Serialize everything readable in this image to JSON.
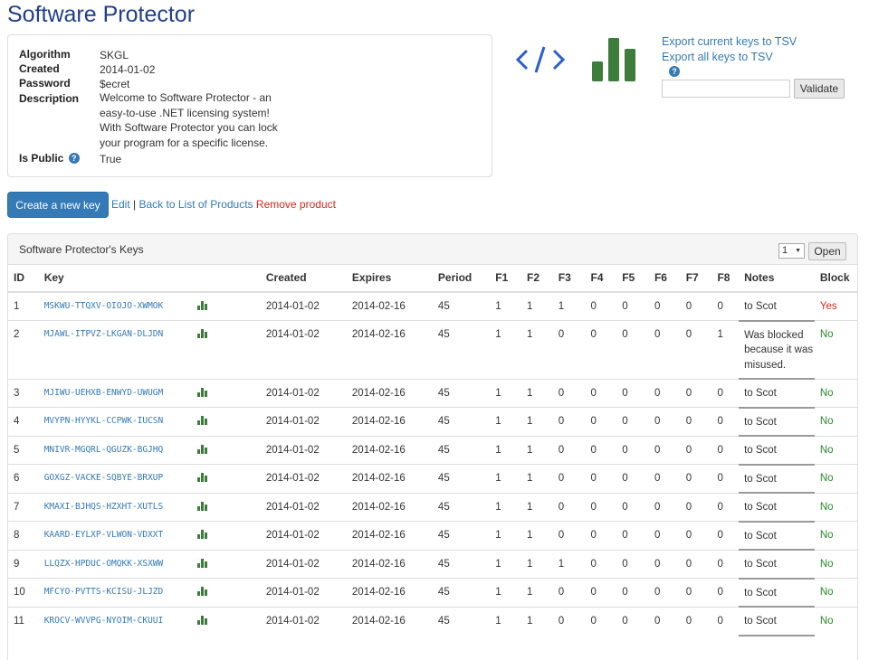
{
  "page": {
    "title": "Software Protector"
  },
  "product": {
    "fields": [
      {
        "label": "Algorithm",
        "value": "SKGL"
      },
      {
        "label": "Created",
        "value": "2014-01-02"
      },
      {
        "label": "Password",
        "value": "$ecret"
      },
      {
        "label": "Description",
        "value": "Welcome to Software Protector - an easy-to-use .NET licensing system! With Software Protector you can lock your program for a specific license."
      },
      {
        "label": "Is Public",
        "value": "True"
      }
    ]
  },
  "links": {
    "export_current": "Export current keys to TSV",
    "export_all": "Export all keys to TSV"
  },
  "validate": {
    "placeholder": "",
    "button": "Validate"
  },
  "actions": {
    "create": "Create a new key",
    "edit": "Edit",
    "separator": "|",
    "back": "Back to List of Products",
    "remove": "Remove product"
  },
  "keys_panel": {
    "title": "Software Protector's Keys",
    "page_value": "1",
    "open_button": "Open",
    "columns": [
      "ID",
      "Key",
      "",
      "Created",
      "Expires",
      "Period",
      "F1",
      "F2",
      "F3",
      "F4",
      "F5",
      "F6",
      "F7",
      "F8",
      "Notes",
      "Block"
    ],
    "rows": [
      {
        "id": "1",
        "key": "MSKWU-TTQXV-OIOJO-XWMOK",
        "created": "2014-01-02",
        "expires": "2014-02-16",
        "period": "45",
        "f": [
          "1",
          "1",
          "1",
          "0",
          "0",
          "0",
          "0",
          "0"
        ],
        "notes": "to Scot",
        "block": "Yes"
      },
      {
        "id": "2",
        "key": "MJAWL-ITPVZ-LKGAN-DLJDN",
        "created": "2014-01-02",
        "expires": "2014-02-16",
        "period": "45",
        "f": [
          "1",
          "1",
          "0",
          "0",
          "0",
          "0",
          "0",
          "1"
        ],
        "notes": "Was blocked because it was misused.",
        "block": "No"
      },
      {
        "id": "3",
        "key": "MJIWU-UEHXB-ENWYD-UWUGM",
        "created": "2014-01-02",
        "expires": "2014-02-16",
        "period": "45",
        "f": [
          "1",
          "1",
          "0",
          "0",
          "0",
          "0",
          "0",
          "0"
        ],
        "notes": "to Scot",
        "block": "No"
      },
      {
        "id": "4",
        "key": "MVYPN-HYYKL-CCPWK-IUCSN",
        "created": "2014-01-02",
        "expires": "2014-02-16",
        "period": "45",
        "f": [
          "1",
          "1",
          "0",
          "0",
          "0",
          "0",
          "0",
          "0"
        ],
        "notes": "to Scot",
        "block": "No"
      },
      {
        "id": "5",
        "key": "MNIVR-MGQRL-QGUZK-BGJHQ",
        "created": "2014-01-02",
        "expires": "2014-02-16",
        "period": "45",
        "f": [
          "1",
          "1",
          "0",
          "0",
          "0",
          "0",
          "0",
          "0"
        ],
        "notes": "to Scot",
        "block": "No"
      },
      {
        "id": "6",
        "key": "GOXGZ-VACKE-SQBYE-BRXUP",
        "created": "2014-01-02",
        "expires": "2014-02-16",
        "period": "45",
        "f": [
          "1",
          "1",
          "0",
          "0",
          "0",
          "0",
          "0",
          "0"
        ],
        "notes": "to Scot",
        "block": "No"
      },
      {
        "id": "7",
        "key": "KMAXI-BJHQS-HZXHT-XUTLS",
        "created": "2014-01-02",
        "expires": "2014-02-16",
        "period": "45",
        "f": [
          "1",
          "1",
          "0",
          "0",
          "0",
          "0",
          "0",
          "0"
        ],
        "notes": "to Scot",
        "block": "No"
      },
      {
        "id": "8",
        "key": "KAARD-EYLXP-VLWON-VDXXT",
        "created": "2014-01-02",
        "expires": "2014-02-16",
        "period": "45",
        "f": [
          "1",
          "1",
          "0",
          "0",
          "0",
          "0",
          "0",
          "0"
        ],
        "notes": "to Scot",
        "block": "No"
      },
      {
        "id": "9",
        "key": "LLQZX-HPDUC-OMQKK-XSXWW",
        "created": "2014-01-02",
        "expires": "2014-02-16",
        "period": "45",
        "f": [
          "1",
          "1",
          "1",
          "0",
          "0",
          "0",
          "0",
          "0"
        ],
        "notes": "to Scot",
        "block": "No"
      },
      {
        "id": "10",
        "key": "MFCYO-PVTTS-KCISU-JLJZD",
        "created": "2014-01-02",
        "expires": "2014-02-16",
        "period": "45",
        "f": [
          "1",
          "1",
          "0",
          "0",
          "0",
          "0",
          "0",
          "0"
        ],
        "notes": "to Scot",
        "block": "No"
      },
      {
        "id": "11",
        "key": "KROCV-WVVPG-NYOIM-CKUUI",
        "created": "2014-01-02",
        "expires": "2014-02-16",
        "period": "45",
        "f": [
          "1",
          "1",
          "0",
          "0",
          "0",
          "0",
          "0",
          "0"
        ],
        "notes": "to Scot",
        "block": "No"
      }
    ]
  },
  "colors": {
    "brand_title": "#1f3f8a",
    "link": "#337ab7",
    "primary": "#337ab7",
    "danger": "#d9261c",
    "success": "#2a8a2a",
    "chart_green": "#3c7d3c"
  },
  "icons": [
    "code-icon",
    "bar-chart-icon",
    "help-icon",
    "key-stats-icon"
  ]
}
